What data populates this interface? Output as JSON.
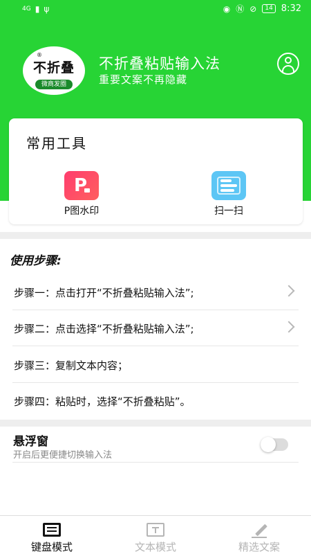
{
  "status_bar": {
    "network": "4G",
    "battery": "14",
    "time": "8:32"
  },
  "header": {
    "logo_text": "不折叠",
    "logo_subtext": "微商发圈",
    "logo_reg": "®",
    "title": "不折叠粘贴输入法",
    "subtitle": "重要文案不再隐藏"
  },
  "tools": {
    "title": "常用工具",
    "items": [
      {
        "label": "P图水印",
        "icon": "p-watermark-icon",
        "color": "#ff4a6a"
      },
      {
        "label": "扫一扫",
        "icon": "scan-icon",
        "color": "#5dc6f5"
      }
    ]
  },
  "steps": {
    "heading": "使用步骤:",
    "items": [
      {
        "text": "步骤一：点击打开“不折叠粘贴输入法”;"
      },
      {
        "text": "步骤二：点击选择“不折叠粘贴输入法”;"
      },
      {
        "text": "步骤三：复制文本内容；"
      },
      {
        "text": "步骤四：粘贴时，选择“不折叠粘贴”。"
      }
    ]
  },
  "floating_window": {
    "title": "悬浮窗",
    "description": "开启后更便捷切换输入法",
    "enabled": false
  },
  "bottom_nav": {
    "items": [
      {
        "label": "键盘模式",
        "icon": "keyboard-icon",
        "active": true
      },
      {
        "label": "文本模式",
        "icon": "text-icon",
        "active": false
      },
      {
        "label": "精选文案",
        "icon": "pen-icon",
        "active": false
      }
    ]
  },
  "colors": {
    "brand_green": "#27d435",
    "inactive_gray": "#b5b5b5"
  }
}
